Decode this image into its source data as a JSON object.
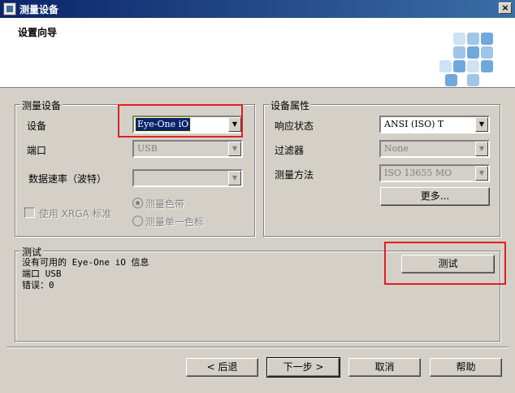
{
  "window": {
    "title": "测量设备"
  },
  "header": {
    "heading": "设置向导"
  },
  "device_group": {
    "legend": "测量设备",
    "device_label": "设备",
    "device_value": "Eye-One iO",
    "port_label": "端口",
    "port_value": "USB",
    "baud_label": "数据速率（波特）",
    "baud_value": "",
    "xrga_label": "使用 XRGA 标准",
    "radio_strip": "测量色带",
    "radio_single": "测量单一色标"
  },
  "props_group": {
    "legend": "设备属性",
    "response_label": "响应状态",
    "response_value": "ANSI (ISO) T",
    "filter_label": "过滤器",
    "filter_value": "None",
    "method_label": "测量方法",
    "method_value": "ISO 13655 MO",
    "more_button": "更多..."
  },
  "test_group": {
    "legend": "测试",
    "lines": [
      "没有可用的 Eye-One iO 信息",
      "端口 USB",
      "错误：0"
    ],
    "test_button": "测试"
  },
  "footer": {
    "back_button": "< 后退",
    "next_button": "下一步 >",
    "cancel_button": "取消",
    "help_button": "帮助"
  },
  "colors": {
    "title_bar": "#0a246a",
    "highlight": "#e02020",
    "logo_blue": "#6fa8dc",
    "logo_light": "#cfe2f3"
  }
}
